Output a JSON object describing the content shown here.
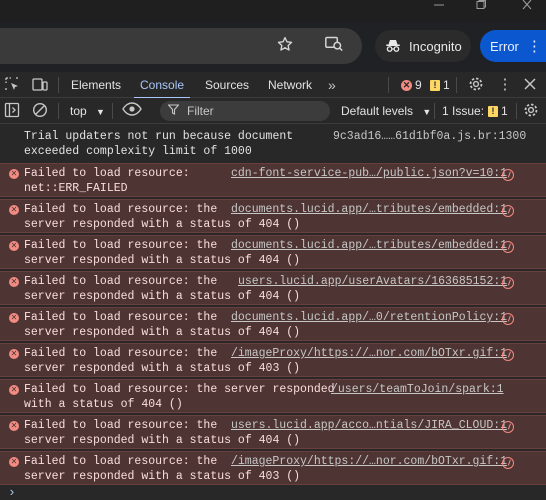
{
  "colors": {
    "accent": "#a8c7fa",
    "error_bg": "#4e3534",
    "error_icon": "#f28b82",
    "warning": "#fdd663",
    "error_button": "#0b57d0"
  },
  "window": {
    "minimize_icon": "minimize-icon",
    "restore_icon": "restore-icon",
    "close_icon": "close-icon"
  },
  "toolbar": {
    "bookmark_icon": "star-icon",
    "lens_icon": "lens-icon",
    "incognito_label": "Incognito",
    "error_label": "Error",
    "menu_icon": "kebab-icon"
  },
  "devtools": {
    "tabs": [
      {
        "label": "Elements"
      },
      {
        "label": "Console",
        "active": true
      },
      {
        "label": "Sources"
      },
      {
        "label": "Network"
      }
    ],
    "more_tabs": "»",
    "error_count": "9",
    "warning_count": "1"
  },
  "console_bar": {
    "context": "top",
    "filter_placeholder": "Filter",
    "levels": "Default levels",
    "issues_label": "1 Issue:",
    "issues_count": "1"
  },
  "messages": [
    {
      "type": "info",
      "text": "Trial updaters not run because document\nexceeded complexity limit of 1000",
      "source": "9c3ad16……61d1bf0a.js.br:1300"
    },
    {
      "type": "error",
      "text": "Failed to load resource:\nnet::ERR_FAILED",
      "source": "cdn-font-service-pub…/public.json?v=10:1"
    },
    {
      "type": "error",
      "text": "Failed to load resource: the\nserver responded with a status of 404 ()",
      "source": "documents.lucid.app/…tributes/embedded:1"
    },
    {
      "type": "error",
      "text": "Failed to load resource: the\nserver responded with a status of 404 ()",
      "source": "documents.lucid.app/…tributes/embedded:1"
    },
    {
      "type": "error",
      "text": "Failed to load resource: the\nserver responded with a status of 404 ()",
      "source": "users.lucid.app/userAvatars/163685152:1"
    },
    {
      "type": "error",
      "text": "Failed to load resource: the\nserver responded with a status of 404 ()",
      "source": "documents.lucid.app/…0/retentionPolicy:1"
    },
    {
      "type": "error",
      "text": "Failed to load resource: the\nserver responded with a status of 403 ()",
      "source": "/imageProxy/https://…nor.com/bOTxr.gif:1"
    },
    {
      "type": "error",
      "text": "Failed to load resource: the server responded\nwith a status of 404 ()",
      "source": "/users/teamToJoin/spark:1"
    },
    {
      "type": "error",
      "text": "Failed to load resource: the\nserver responded with a status of 404 ()",
      "source": "users.lucid.app/acco…ntials/JIRA_CLOUD:1"
    },
    {
      "type": "error",
      "text": "Failed to load resource: the\nserver responded with a status of 403 ()",
      "source": "/imageProxy/https://…nor.com/bOTxr.gif:1"
    }
  ],
  "prompt_symbol": "›"
}
